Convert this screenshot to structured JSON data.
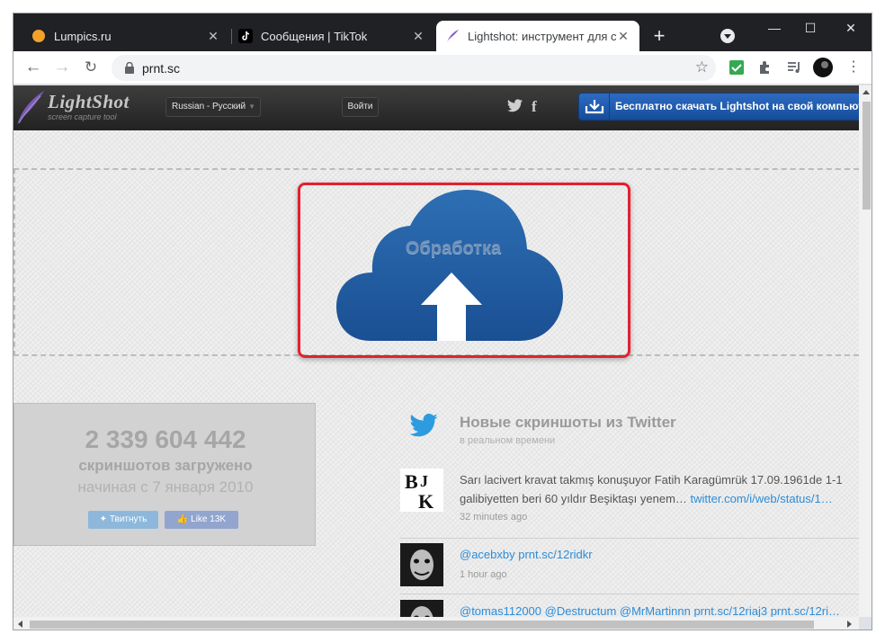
{
  "browser": {
    "tabs": [
      {
        "title": "Lumpics.ru",
        "icon": "lumpics-favicon",
        "active": false
      },
      {
        "title": "Сообщения | TikTok",
        "icon": "tiktok-favicon",
        "active": false
      },
      {
        "title": "Lightshot: инструмент для скр",
        "icon": "lightshot-favicon",
        "active": true
      }
    ],
    "new_tab": "+",
    "url": "prnt.sc",
    "window_controls": {
      "minimize": "—",
      "maximize": "☐",
      "close": "✕"
    }
  },
  "site": {
    "logo_text": "LightShot",
    "logo_sub": "screen capture tool",
    "language": "Russian - Русский",
    "login": "Войти",
    "download": "Бесплатно скачать Lightshot на свой компьютер"
  },
  "upload": {
    "processing": "Обработка"
  },
  "stats": {
    "count": "2 339 604 442",
    "label": "скриншотов загружено",
    "since": "начиная с 7 января 2010",
    "tweet": "Твитнуть",
    "like": "Like",
    "like_count": "13K"
  },
  "feed": {
    "title": "Новые скриншоты из Twitter",
    "subtitle": "в реальном времени",
    "items": [
      {
        "line1": "Sarı lacivert kravat takmış konuşuyor Fatih Karagümrük 17.09.1961de 1-1",
        "line2": "galibiyetten beri 60 yıldır Beşiktaşı yenem…",
        "link": "twitter.com/i/web/status/1…",
        "time": "32 minutes ago"
      },
      {
        "text": "@acebxby prnt.sc/12ridkr",
        "time": "1 hour ago"
      },
      {
        "text": "@tomas112000 @Destructum @MrMartinnn prnt.sc/12riaj3 prnt.sc/12ri…"
      }
    ]
  },
  "colors": {
    "accent_red": "#e4202e",
    "cloud_blue": "#2563a8",
    "download_blue": "#1f5cb0",
    "twitter_blue": "#2c8dd8"
  }
}
